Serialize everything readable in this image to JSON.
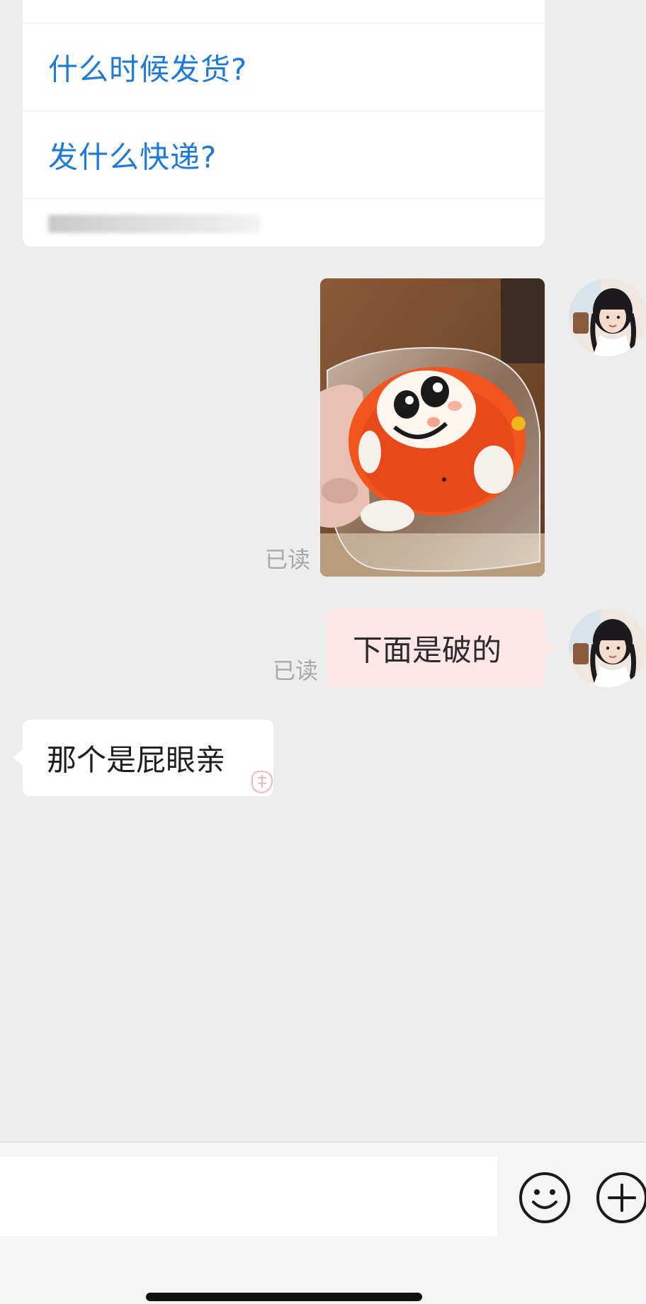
{
  "quick_questions": {
    "items": [
      {
        "label": "什么时候发货?"
      },
      {
        "label": "发什么快递?"
      }
    ]
  },
  "messages": {
    "image_message": {
      "read_status": "已读"
    },
    "text_message_right": {
      "text": "下面是破的",
      "read_status": "已读"
    },
    "text_message_left": {
      "text": "那个是屁眼亲"
    }
  },
  "input_bar": {
    "value": ""
  },
  "icons": {
    "emoji": "emoji-face-icon",
    "plus": "plus-icon"
  },
  "colors": {
    "question_link": "#1f7ad6",
    "sent_bubble": "#fde7e6",
    "received_bubble": "#ffffff",
    "background": "#ededed"
  }
}
